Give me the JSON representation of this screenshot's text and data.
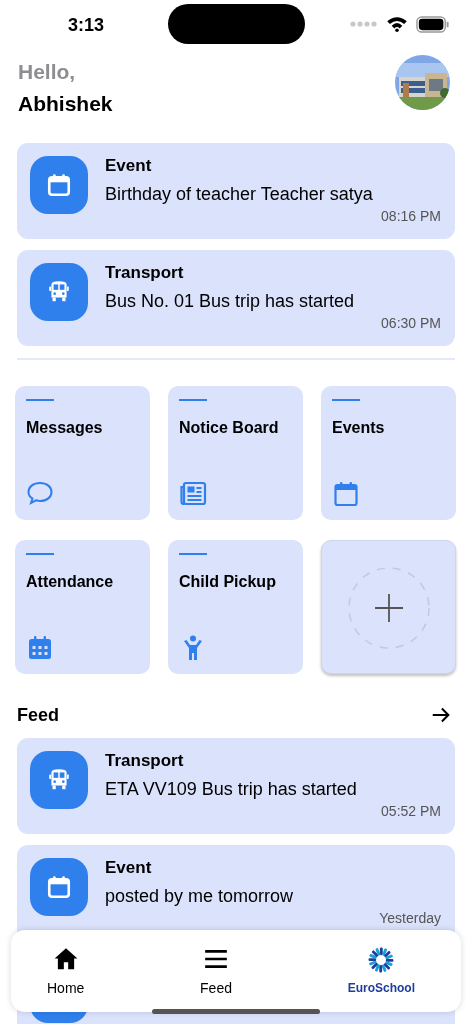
{
  "status_bar": {
    "time": "3:13"
  },
  "greeting": {
    "hello": "Hello,",
    "name": "Abhishek"
  },
  "notifications": [
    {
      "kind": "event",
      "title": "Event",
      "message": "Birthday of teacher Teacher satya",
      "time": "08:16 PM"
    },
    {
      "kind": "transport",
      "title": "Transport",
      "message": "Bus No. 01 Bus trip has started",
      "time": "06:30 PM"
    }
  ],
  "tiles": [
    {
      "kind": "messages",
      "label": "Messages"
    },
    {
      "kind": "notice",
      "label": "Notice Board"
    },
    {
      "kind": "events",
      "label": "Events"
    },
    {
      "kind": "attendance",
      "label": "Attendance"
    },
    {
      "kind": "pickup",
      "label": "Child Pickup"
    },
    {
      "kind": "add"
    }
  ],
  "feed": {
    "title": "Feed",
    "items": [
      {
        "kind": "transport",
        "title": "Transport",
        "message": "ETA VV109  Bus trip has started",
        "time": "05:52 PM"
      },
      {
        "kind": "event",
        "title": "Event",
        "message": "posted by me tomorrow",
        "time": "Yesterday"
      },
      {
        "kind": "partial"
      }
    ]
  },
  "nav": [
    {
      "kind": "home",
      "label": "Home"
    },
    {
      "kind": "menu",
      "label": "Feed"
    },
    {
      "kind": "logo",
      "label": "EuroSchool"
    }
  ]
}
